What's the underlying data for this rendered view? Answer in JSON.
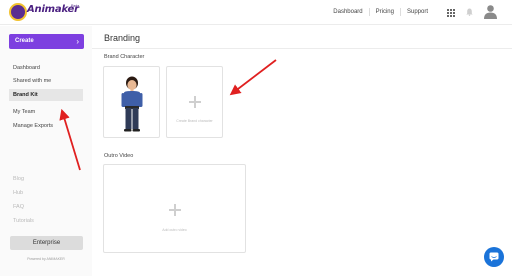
{
  "header": {
    "logo_text": "Animaker",
    "logo_tm": "Beta",
    "nav": [
      "Dashboard",
      "Pricing",
      "Support"
    ]
  },
  "sidebar": {
    "create_label": "Create",
    "create_chevron": "›",
    "items": [
      "Dashboard",
      "Shared with me",
      "Brand Kit",
      "My Team",
      "Manage Exports"
    ],
    "active_index": 2,
    "links": [
      "Blog",
      "Hub",
      "FAQ",
      "Tutorials"
    ],
    "enterprise_label": "Enterprise",
    "powered_by": "Powered by ANIMAKER"
  },
  "main": {
    "title": "Branding",
    "brand_character": {
      "label": "Brand Character",
      "create_hint": "Create Brand character"
    },
    "outro_video": {
      "label": "Outro Video",
      "add_hint": "Add outro video"
    }
  },
  "colors": {
    "accent": "#7d3fe0",
    "annotation": "#e02020",
    "chat": "#1a73d9"
  }
}
